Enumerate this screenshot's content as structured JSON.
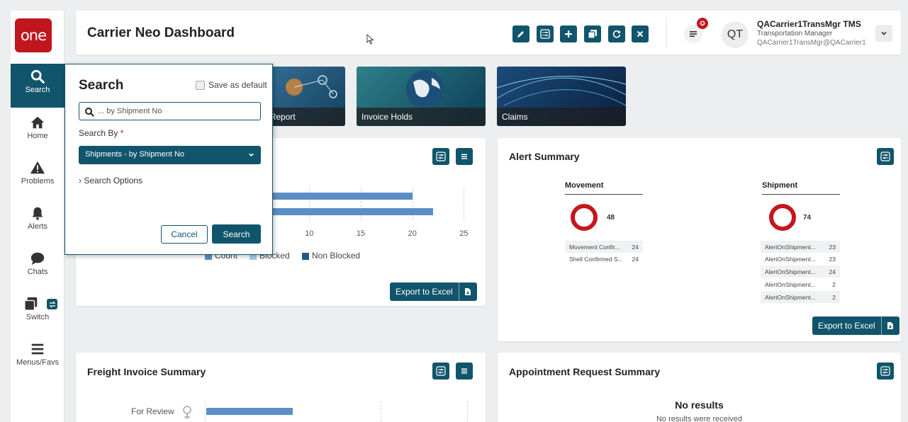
{
  "header": {
    "title": "Carrier Neo Dashboard",
    "user_name": "QACarrier1TransMgr TMS",
    "user_role": "Transportation Manager",
    "user_email": "QACarrier1TransMgr@QACarrier1",
    "avatar_initials": "QT"
  },
  "logo": "one",
  "nav": {
    "items": [
      {
        "label": "Search",
        "icon": "search-icon",
        "active": true
      },
      {
        "label": "Home",
        "icon": "home-icon"
      },
      {
        "label": "Problems",
        "icon": "warning-icon"
      },
      {
        "label": "Alerts",
        "icon": "bell-icon"
      },
      {
        "label": "Chats",
        "icon": "chat-icon"
      },
      {
        "label": "Switch",
        "icon": "switch-icon"
      },
      {
        "label": "Menus/Favs",
        "icon": "hamburger-icon"
      }
    ]
  },
  "toolbar": {
    "buttons": [
      "edit-icon",
      "list-icon",
      "add-icon",
      "copy-icon",
      "refresh-icon",
      "close-icon"
    ]
  },
  "tiles": [
    {
      "label": "ppointments Report"
    },
    {
      "label": "Invoice Holds"
    },
    {
      "label": "Claims"
    }
  ],
  "search": {
    "title": "Search",
    "save_default_label": "Save as default",
    "input_placeholder": "... by Shipment No",
    "search_by_label": "Search By",
    "required_mark": "*",
    "search_by_value": "Shipments - by Shipment No",
    "options_label": "Search Options",
    "cancel_label": "Cancel",
    "submit_label": "Search"
  },
  "problem_card": {
    "export_label": "Export to Excel",
    "legend": [
      {
        "name": "Count",
        "color": "#5b8ec4"
      },
      {
        "name": "Blocked",
        "color": "#9fd0e8"
      },
      {
        "name": "Non Blocked",
        "color": "#215a85"
      }
    ]
  },
  "alert_summary": {
    "title": "Alert Summary",
    "export_label": "Export to Excel",
    "movement": {
      "title": "Movement",
      "total": "48",
      "rows": [
        {
          "name": "Movement Confir...",
          "count": "24"
        },
        {
          "name": "Shell Confirmed S...",
          "count": "24"
        }
      ]
    },
    "shipment": {
      "title": "Shipment",
      "total": "74",
      "rows": [
        {
          "name": "AlertOnShipment...",
          "count": "23"
        },
        {
          "name": "AlertOnShipment...",
          "count": "23"
        },
        {
          "name": "AlertOnShipment...",
          "count": "24"
        },
        {
          "name": "AlertOnShipment...",
          "count": "2"
        },
        {
          "name": "AlertOnShipment...",
          "count": "2"
        }
      ]
    }
  },
  "freight_invoice": {
    "title": "Freight Invoice Summary",
    "first_category": "For Review"
  },
  "appointment_request": {
    "title": "Appointment Request Summary",
    "no_results_title": "No results",
    "no_results_sub": "No results were received"
  },
  "chart_data": [
    {
      "type": "bar",
      "orientation": "horizontal",
      "title": "",
      "x_ticks": [
        "10",
        "15",
        "20",
        "25"
      ],
      "xlim": [
        0,
        25
      ],
      "categories": [
        "",
        ""
      ],
      "series": [
        {
          "name": "Count",
          "values": [
            20,
            22
          ]
        }
      ],
      "legend": [
        "Count",
        "Blocked",
        "Non Blocked"
      ],
      "legend_position": "bottom"
    },
    {
      "type": "bar",
      "orientation": "horizontal",
      "title": "Freight Invoice Summary",
      "categories": [
        "For Review"
      ],
      "series": [
        {
          "values": [
            1
          ]
        }
      ]
    }
  ],
  "colors": {
    "accent": "#10556b",
    "brand_red": "#c0161d",
    "bar": "#5b8ec4"
  }
}
